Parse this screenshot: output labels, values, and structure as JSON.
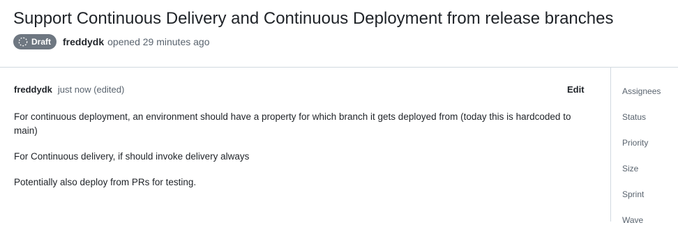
{
  "issue": {
    "title": "Support Continuous Delivery and Continuous Deployment from release branches",
    "status_badge": "Draft",
    "author": "freddydk",
    "opened_text": "opened 29 minutes ago"
  },
  "comment": {
    "author": "freddydk",
    "timestamp": "just now (edited)",
    "edit_label": "Edit",
    "paragraphs": [
      "For continuous deployment, an environment should have a property for which branch it gets deployed from (today this is hardcoded to main)",
      "For Continuous delivery, if should invoke delivery always",
      "Potentially also deploy from PRs for testing."
    ]
  },
  "sidebar": {
    "fields": [
      "Assignees",
      "Status",
      "Priority",
      "Size",
      "Sprint",
      "Wave"
    ]
  },
  "colors": {
    "badge_bg": "#6e7781",
    "text": "#1f2328",
    "muted": "#59636e",
    "border": "#d1d9e0"
  },
  "icons": {
    "draft": "draft-circle-icon"
  }
}
